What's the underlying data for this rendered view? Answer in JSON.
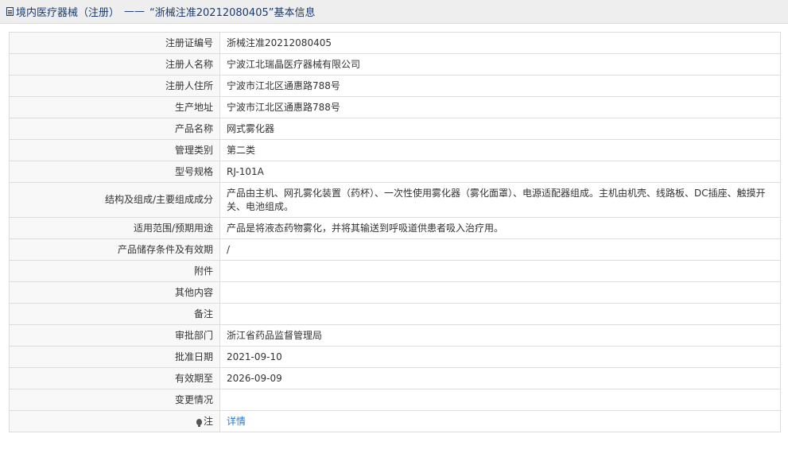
{
  "header": {
    "category": "境内医疗器械（注册）",
    "separator": "——",
    "title": "“浙械注准20212080405”基本信息"
  },
  "rows": [
    {
      "label": "注册证编号",
      "value": "浙械注准20212080405"
    },
    {
      "label": "注册人名称",
      "value": "宁波江北瑞晶医疗器械有限公司"
    },
    {
      "label": "注册人住所",
      "value": "宁波市江北区通惠路788号"
    },
    {
      "label": "生产地址",
      "value": "宁波市江北区通惠路788号"
    },
    {
      "label": "产品名称",
      "value": "网式雾化器"
    },
    {
      "label": "管理类别",
      "value": "第二类"
    },
    {
      "label": "型号规格",
      "value": "RJ-101A"
    },
    {
      "label": "结构及组成/主要组成成分",
      "value": "产品由主机、网孔雾化装置（药杯）、一次性使用雾化器（雾化面罩）、电源适配器组成。主机由机壳、线路板、DC插座、触摸开关、电池组成。"
    },
    {
      "label": "适用范围/预期用途",
      "value": "产品是将液态药物雾化，并将其输送到呼吸道供患者吸入治疗用。"
    },
    {
      "label": "产品储存条件及有效期",
      "value": "/"
    },
    {
      "label": "附件",
      "value": ""
    },
    {
      "label": "其他内容",
      "value": ""
    },
    {
      "label": "备注",
      "value": ""
    },
    {
      "label": "审批部门",
      "value": "浙江省药品监督管理局"
    },
    {
      "label": "批准日期",
      "value": "2021-09-10"
    },
    {
      "label": "有效期至",
      "value": "2026-09-09"
    },
    {
      "label": "变更情况",
      "value": ""
    }
  ],
  "note": {
    "icon": "bulb-icon",
    "label": "注",
    "link_text": "详情"
  }
}
